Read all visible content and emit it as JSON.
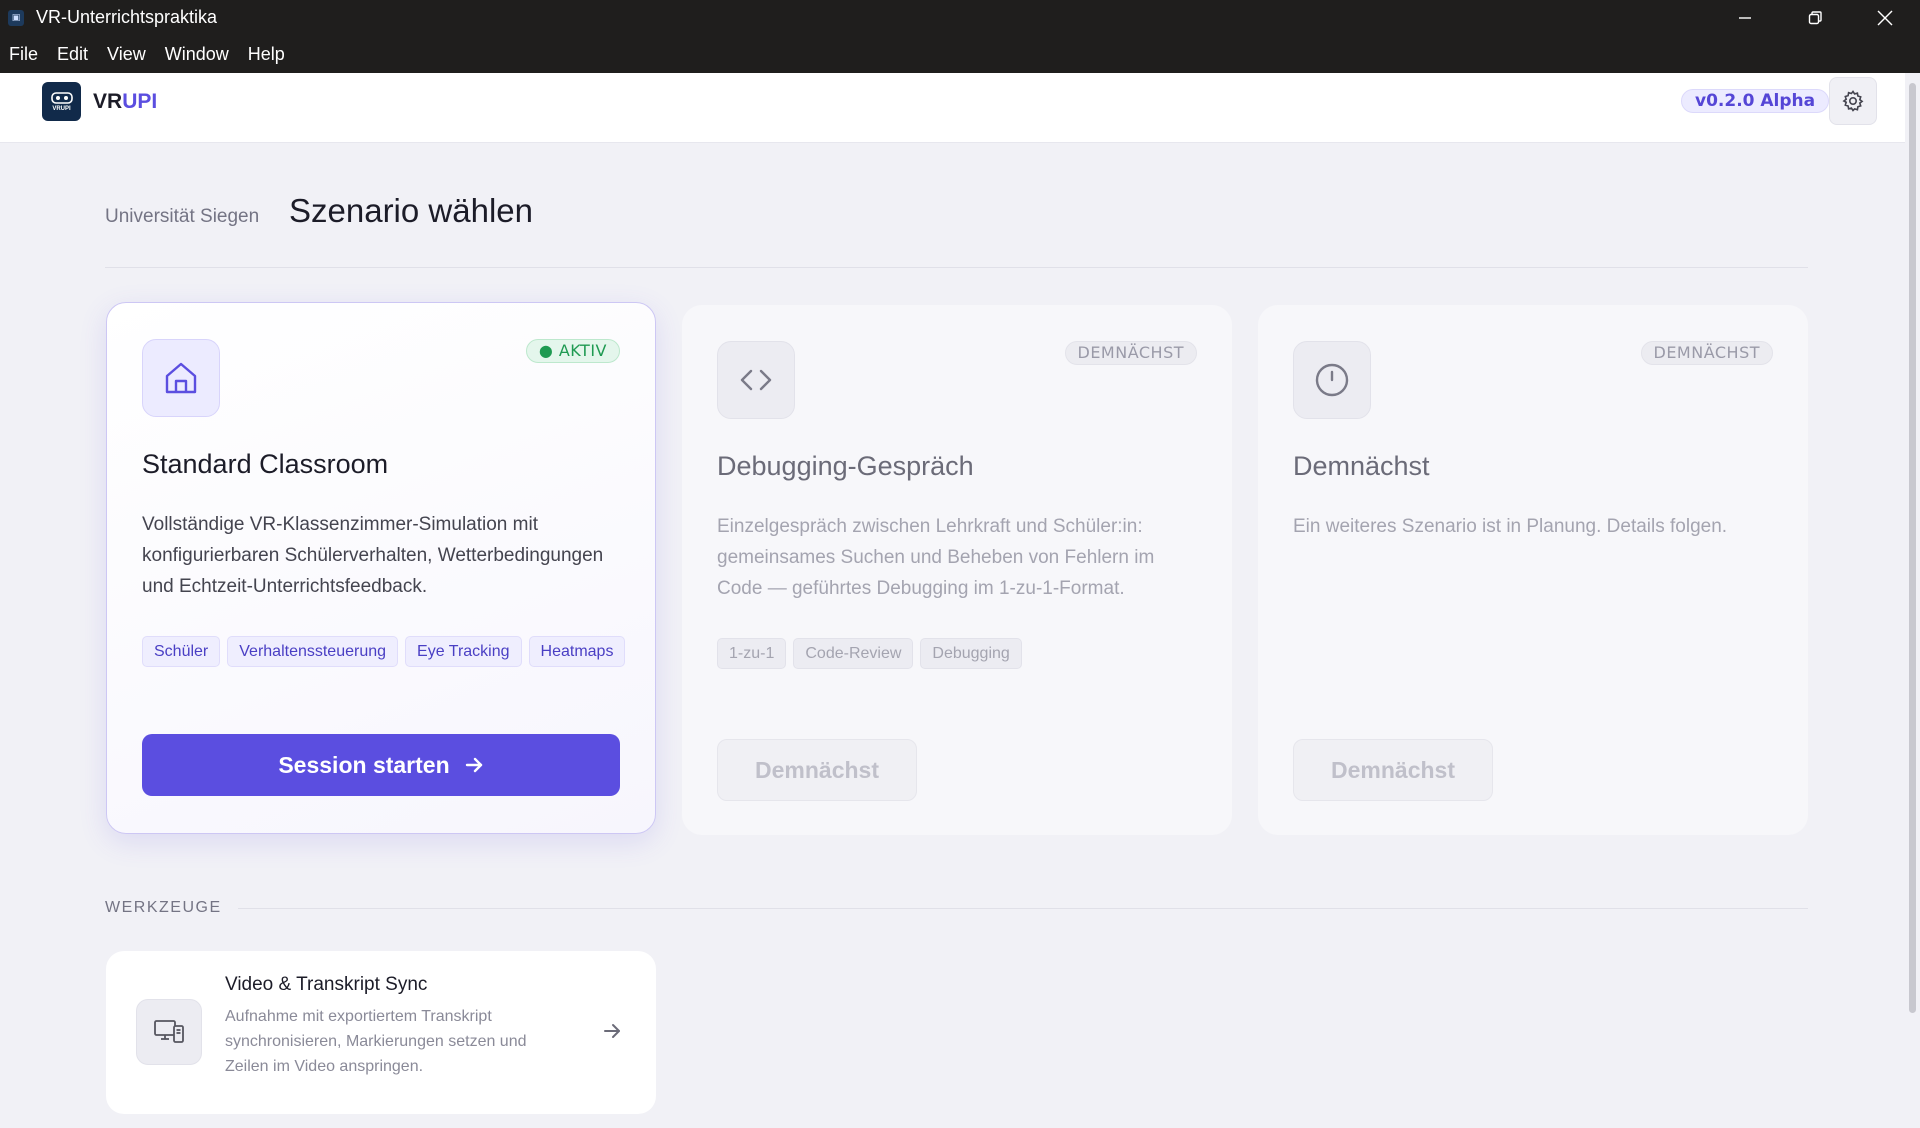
{
  "window": {
    "title": "VR-Unterrichtspraktika",
    "menu": [
      "File",
      "Edit",
      "View",
      "Window",
      "Help"
    ]
  },
  "header": {
    "logo_text": "VRUPI",
    "brand_vr": "VR",
    "brand_upi": "UPI",
    "version": "v0.2.0 Alpha"
  },
  "main": {
    "subtitle": "Universität Siegen",
    "title": "Szenario wählen"
  },
  "scenarios": [
    {
      "title": "Standard Classroom",
      "status": "AKTIV",
      "description": "Vollständige VR-Klassenzimmer-Simulation mit konfigurierbaren Schülerverhalten, Wetterbedingungen und Echtzeit-Unterrichtsfeedback.",
      "tags": [
        "Schüler",
        "Verhaltenssteuerung",
        "Eye Tracking",
        "Heatmaps"
      ],
      "button": "Session starten",
      "icon": "home-icon"
    },
    {
      "title": "Debugging-Gespräch",
      "status": "DEMNÄCHST",
      "description": "Einzelgespräch zwischen Lehrkraft und Schüler:in: gemeinsames Suchen und Beheben von Fehlern im Code — geführtes Debugging im 1-zu-1-Format.",
      "tags": [
        "1-zu-1",
        "Code-Review",
        "Debugging"
      ],
      "button": "Demnächst",
      "icon": "code-icon"
    },
    {
      "title": "Demnächst",
      "status": "DEMNÄCHST",
      "description": "Ein weiteres Szenario ist in Planung. Details folgen.",
      "tags": [],
      "button": "Demnächst",
      "icon": "clock-icon"
    }
  ],
  "tools": {
    "label": "WERKZEUGE",
    "items": [
      {
        "title": "Video & Transkript Sync",
        "description": "Aufnahme mit exportiertem Transkript synchronisieren, Markierungen setzen und Zeilen im Video anspringen.",
        "icon": "monitor-icon"
      }
    ]
  },
  "colors": {
    "accent": "#5b4ee0",
    "active_green": "#1f9a52",
    "background": "#f1f1f6"
  }
}
